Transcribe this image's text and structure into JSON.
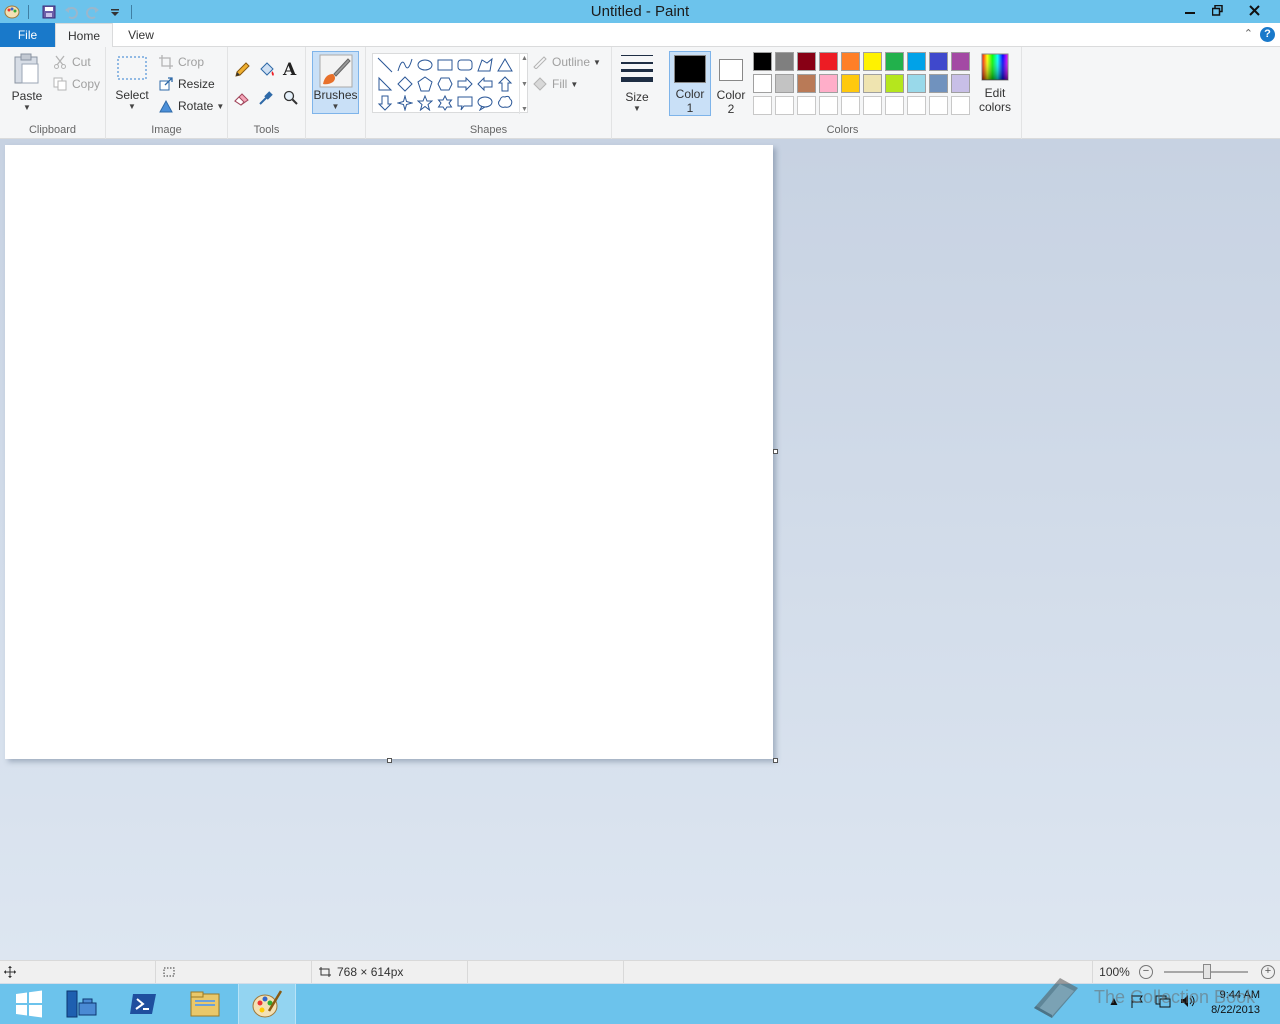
{
  "window": {
    "title": "Untitled - Paint",
    "minimize_icon": "minimize-icon",
    "maximize_icon": "restore-icon",
    "close_icon": "close-icon"
  },
  "quick_access": {
    "icons": [
      "paint-app-icon",
      "save-icon",
      "undo-icon",
      "redo-icon",
      "customize-dropdown-icon"
    ]
  },
  "tabs": {
    "file": "File",
    "home": "Home",
    "view": "View"
  },
  "ribbon": {
    "clipboard": {
      "label": "Clipboard",
      "paste": "Paste",
      "cut": "Cut",
      "copy": "Copy"
    },
    "image": {
      "label": "Image",
      "select": "Select",
      "crop": "Crop",
      "resize": "Resize",
      "rotate": "Rotate"
    },
    "tools": {
      "label": "Tools"
    },
    "brushes": {
      "label": "Brushes"
    },
    "shapes": {
      "label": "Shapes",
      "outline": "Outline",
      "fill": "Fill"
    },
    "size": {
      "label": "Size"
    },
    "colors": {
      "label": "Colors",
      "color1_line1": "Color",
      "color1_line2": "1",
      "color2_line1": "Color",
      "color2_line2": "2",
      "edit_line1": "Edit",
      "edit_line2": "colors",
      "color1_value": "#000000",
      "color2_value": "#ffffff",
      "palette_row1": [
        "#000000",
        "#7f7f7f",
        "#880015",
        "#ed1c24",
        "#ff7f27",
        "#fff200",
        "#22b14c",
        "#00a2e8",
        "#3f48cc",
        "#a349a4"
      ],
      "palette_row2": [
        "#ffffff",
        "#c3c3c3",
        "#b97a57",
        "#ffaec9",
        "#ffc90e",
        "#efe4b0",
        "#b5e61d",
        "#99d9ea",
        "#7092be",
        "#c8bfe7"
      ],
      "palette_row3_count": 10
    }
  },
  "status": {
    "canvas_size": "768 × 614px",
    "zoom": "100%"
  },
  "taskbar": {
    "time": "9:44 AM",
    "date": "8/22/2013",
    "apps": [
      "windows-start-icon",
      "server-manager-icon",
      "powershell-icon",
      "file-explorer-icon",
      "paint-icon"
    ]
  },
  "watermark": {
    "text": "The Collection Book"
  }
}
